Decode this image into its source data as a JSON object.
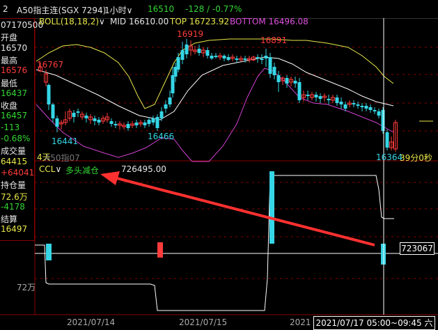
{
  "header": {
    "index": "2",
    "instrument": "A50指主连(SGX 7294)",
    "period": "1小时",
    "last": "16510",
    "change": "-128 / -0.77%"
  },
  "sidebar": [
    {
      "text": "07170500",
      "color": "#e6e6e6"
    },
    {
      "text": "开盘",
      "color": "#e6e6e6"
    },
    {
      "text": "16570",
      "color": "#e6e6e6"
    },
    {
      "text": "最高",
      "color": "#e6e6e6"
    },
    {
      "text": "16576",
      "color": "#ff3b3b"
    },
    {
      "text": "最低",
      "color": "#e6e6e6"
    },
    {
      "text": "16437",
      "color": "#33d633"
    },
    {
      "text": "收盘",
      "color": "#e6e6e6"
    },
    {
      "text": "16457",
      "color": "#33d633"
    },
    {
      "text": "-113",
      "color": "#33d633"
    },
    {
      "text": "-0.68%",
      "color": "#33d633"
    },
    {
      "text": "成交量",
      "color": "#e6e6e6"
    },
    {
      "text": "64415",
      "color": "#e8e84a"
    },
    {
      "text": "+64041",
      "color": "#ff3b3b"
    },
    {
      "text": "持仓量",
      "color": "#e6e6e6"
    },
    {
      "text": "72.6万",
      "color": "#e8e84a"
    },
    {
      "text": "-4178",
      "color": "#33d633"
    },
    {
      "text": "结算",
      "color": "#e6e6e6"
    },
    {
      "text": "16497",
      "color": "#e8e84a"
    }
  ],
  "boll": {
    "name": "BOLL(18,18,2)",
    "mid": "MID 16610.00",
    "top": "TOP 16723.92",
    "bottom": "BOTTOM 16496.08"
  },
  "price_labels": {
    "p16767": "16767",
    "p16919": "16919",
    "p16891": "16891",
    "p16441": "16441",
    "p16466": "16466",
    "p16364": "16364",
    "countdown": "39分0秒",
    "small_left": "4天",
    "sub_left": "A50指07"
  },
  "ccl": {
    "name": "CCL",
    "status": "多头减仓",
    "value": "726495.00",
    "ylabel": "72万",
    "cursor_value": "723067"
  },
  "dates": [
    "2021/07/14",
    "2021/07/15",
    "2021"
  ],
  "cursor_date": "2021/07/17 05:00~09:45 六",
  "colors": {
    "up": "#ff3b3b",
    "down": "#35d6e6",
    "top_band": "#e8e84a",
    "mid_band": "#ffffff",
    "bottom_band": "#d040d0",
    "arrow": "#ff3030"
  }
}
